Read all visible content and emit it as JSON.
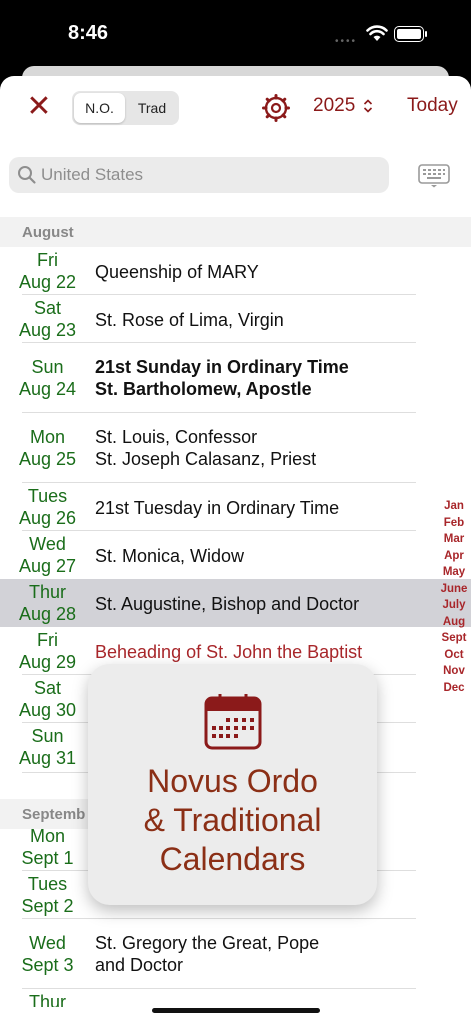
{
  "status_bar": {
    "time": "8:46",
    "dots": "••••"
  },
  "toolbar": {
    "close_glyph": "✕",
    "segments": [
      "N.O.",
      "Trad"
    ],
    "selected_segment": "N.O.",
    "year": "2025",
    "year_chevron": "⌃⌄",
    "today": "Today",
    "accent_color": "#8b1a1a"
  },
  "search": {
    "placeholder": "United States"
  },
  "sections": [
    {
      "label": "August"
    },
    {
      "label": "Septemb"
    }
  ],
  "rows": [
    {
      "day": "Fri",
      "date": "Aug 22",
      "lines": [
        "Queenship of MARY"
      ]
    },
    {
      "day": "Sat",
      "date": "Aug 23",
      "lines": [
        "St. Rose of Lima, Virgin"
      ]
    },
    {
      "day": "Sun",
      "date": "Aug 24",
      "lines": [
        "21st Sunday in Ordinary Time",
        "St. Bartholomew, Apostle"
      ]
    },
    {
      "day": "Mon",
      "date": "Aug 25",
      "lines": [
        "St. Louis, Confessor",
        "St. Joseph Calasanz, Priest"
      ]
    },
    {
      "day": "Tues",
      "date": "Aug 26",
      "lines": [
        "21st Tuesday in Ordinary Time"
      ]
    },
    {
      "day": "Wed",
      "date": "Aug 27",
      "lines": [
        "St. Monica, Widow"
      ]
    },
    {
      "day": "Thur",
      "date": "Aug 28",
      "lines": [
        "St. Augustine, Bishop and Doctor"
      ]
    },
    {
      "day": "Fri",
      "date": "Aug 29",
      "lines": [
        "Beheading of St. John the Baptist"
      ]
    },
    {
      "day": "Sat",
      "date": "Aug 30",
      "lines": []
    },
    {
      "day": "Sun",
      "date": "Aug 31",
      "lines": []
    },
    {
      "day": "Mon",
      "date": "Sept 1",
      "lines": []
    },
    {
      "day": "Tues",
      "date": "Sept 2",
      "lines": []
    },
    {
      "day": "Wed",
      "date": "Sept 3",
      "lines": [
        "St. Gregory the Great, Pope",
        "and Doctor"
      ]
    },
    {
      "day": "Thur",
      "date": "",
      "lines": []
    }
  ],
  "month_index": [
    "Jan",
    "Feb",
    "Mar",
    "Apr",
    "May",
    "June",
    "July",
    "Aug",
    "Sept",
    "Oct",
    "Nov",
    "Dec"
  ],
  "promo": {
    "lines": [
      "Novus Ordo",
      "& Traditional",
      "Calendars"
    ]
  }
}
